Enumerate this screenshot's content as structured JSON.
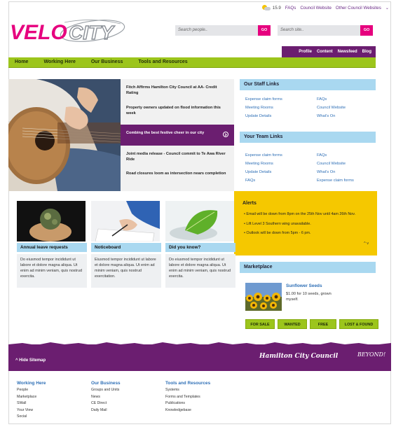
{
  "utility": {
    "weather": "15.9",
    "faqs": "FAQs",
    "council_website": "Council Website",
    "other_websites": "Other Council Websites"
  },
  "logo": {
    "text_a": "VELO",
    "text_b": "CITY"
  },
  "search_people": {
    "placeholder": "Search people..",
    "go": "GO"
  },
  "search_site": {
    "placeholder": "Search site..",
    "go": "GO"
  },
  "personal_nav": [
    "Profile",
    "Content",
    "Newsfeed",
    "Blog"
  ],
  "main_nav": [
    "Home",
    "Working Here",
    "Our Business",
    "Tools and Resources"
  ],
  "news": [
    "Fitch Affirms Hamilton City Council at AA- Credit Rating",
    "Property owners updated on flood information this week",
    "Combing the best festive cheer in our city",
    "Joint media release - Council commit to Te Awa River Ride",
    "Road closures loom as intersection nears completion"
  ],
  "staff_links": {
    "title": "Our Staff Links",
    "left": [
      "Expense claim forms",
      "Meeting Rooms",
      "Update Details"
    ],
    "right": [
      "FAQs",
      "Council Website",
      "What's On"
    ]
  },
  "team_links": {
    "title": "Your Team Links",
    "left": [
      "Expense claim forms",
      "Meeting Rooms",
      "Update Details",
      "FAQs"
    ],
    "right": [
      "FAQs",
      "Council Website",
      "What's On",
      "Expense claim forms"
    ]
  },
  "alerts": {
    "title": "Alerts",
    "items": [
      "Email will be down from 8pm on the 25th Nov until 4am 26th Nov.",
      "Lift Level 3 Southern wing unavailable.",
      "Outlook will be down from 5pm - 6 pm."
    ],
    "pager": "^ v"
  },
  "marketplace": {
    "title": "Marketplace",
    "item_title": "Sunflower Seeds",
    "item_desc": "$1.00 for 10 seeds, grown myself.",
    "buttons": [
      "FOR SALE",
      "WANTED",
      "FREE",
      "LOST & FOUND"
    ]
  },
  "cards": [
    {
      "title": "Annual leave requests",
      "text": "Do eiusmod tempor incididunt ut labore et dolore magna aliqua. Ut enim ad minim veniam, quis nostrud exercita."
    },
    {
      "title": "Noticeboard",
      "text": "Eiusmod tempor incididunt ut labore et dolore magna aliqua. Ut enim ad minim veniam, quis nostrud exercitation."
    },
    {
      "title": "Did you know?",
      "text": "Do eiusmod tempor incididunt ut labore et dolore magna aliqua. Ut enim ad minim veniam, quis nostrud exercita."
    }
  ],
  "footer": {
    "hide_sitemap": "^ Hide Sitemap",
    "hcc": "Hamilton City Council",
    "beyond": "BEYOND!",
    "columns": [
      {
        "title": "Working Here",
        "items": [
          "People",
          "Marketplace",
          "SWall",
          "Your View",
          "Social"
        ]
      },
      {
        "title": "Our Business",
        "items": [
          "Groups and Units",
          "News",
          "CE Direct",
          "Daily Mail"
        ]
      },
      {
        "title": "Tools and Resources",
        "items": [
          "Systems",
          "Forms and Templates",
          "Publications",
          "Knowledgebase"
        ]
      }
    ]
  },
  "colors": {
    "brand_purple": "#6b1e70",
    "brand_pink": "#e6007e",
    "nav_green": "#9cc51c",
    "panel_blue": "#a9d8f0",
    "alert_yellow": "#f5c800"
  }
}
